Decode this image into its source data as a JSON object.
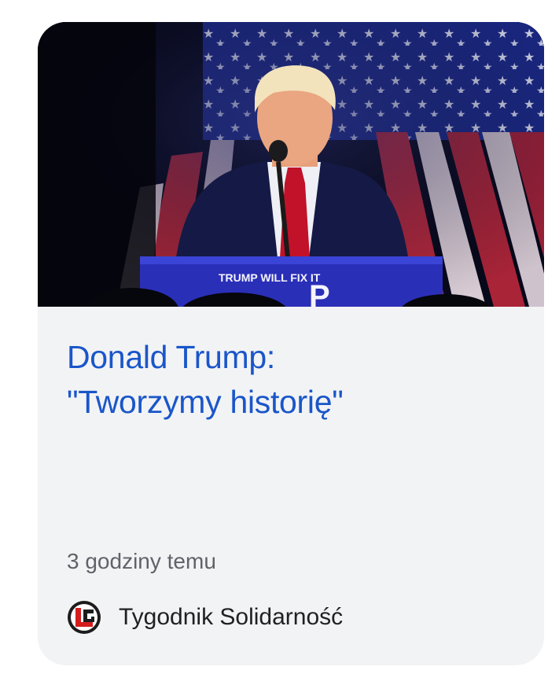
{
  "article": {
    "headline_line1": "Donald Trump:",
    "headline_line2": "\"Tworzymy historię\"",
    "time_ago": "3 godziny temu",
    "source_name": "Tygodnik Solidarność",
    "source_icon": "tygodnik-solidarnosc-logo",
    "podium_text": "TRUMP WILL FIX IT"
  },
  "colors": {
    "headline": "#1a56c9",
    "card_bg": "#f2f3f5",
    "meta_text": "#5f6368",
    "source_text": "#202124"
  }
}
